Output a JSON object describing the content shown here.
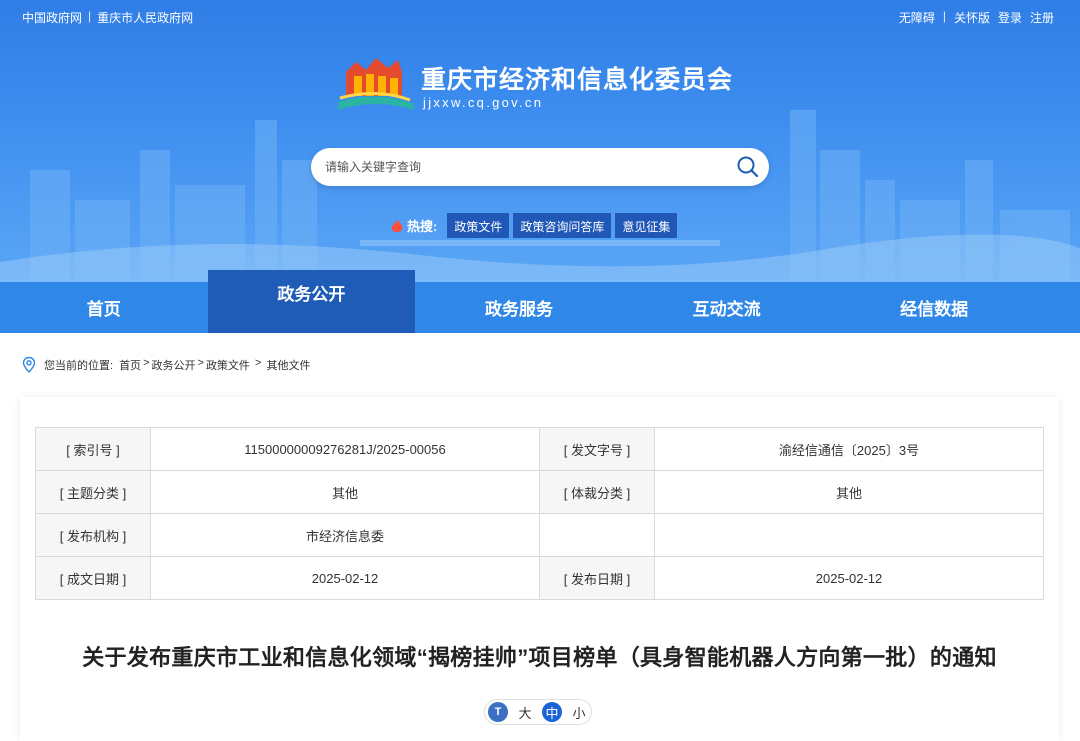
{
  "top_links_left": [
    "中国政府网",
    "重庆市人民政府网"
  ],
  "top_links_right": [
    "无障碍",
    "关怀版",
    "登录",
    "注册"
  ],
  "site": {
    "title": "重庆市经济和信息化委员会",
    "url": "jjxxw.cq.gov.cn"
  },
  "search": {
    "placeholder": "请输入关键字查询"
  },
  "hot": {
    "label": "热搜:",
    "tags": [
      "政策文件",
      "政策咨询问答库",
      "意见征集"
    ]
  },
  "nav": [
    "首页",
    "政务公开",
    "政务服务",
    "互动交流",
    "经信数据"
  ],
  "nav_active_index": 1,
  "breadcrumb": {
    "label": "您当前的位置:",
    "path": [
      "首页",
      ">",
      "政务公开",
      ">",
      "政策文件",
      " > ",
      "其他文件"
    ]
  },
  "meta": {
    "rows": [
      [
        "[ 索引号 ]",
        "11500000009276281J/2025-00056",
        "[ 发文字号 ]",
        "渝经信通信〔2025〕3号"
      ],
      [
        "[ 主题分类 ]",
        "其他",
        "[ 体裁分类 ]",
        "其他"
      ],
      [
        "[ 发布机构 ]",
        "市经济信息委",
        "",
        ""
      ],
      [
        "[ 成文日期 ]",
        "2025-02-12",
        "[ 发布日期 ]",
        "2025-02-12"
      ]
    ]
  },
  "doc_title": "关于发布重庆市工业和信息化领域“揭榜挂帅”项目榜单（具身智能机器人方向第一批）的通知",
  "font_size": {
    "icon": "T",
    "options": [
      "大",
      "中",
      "小"
    ],
    "active": "中"
  },
  "colors": {
    "brand_blue": "#2f87e8",
    "nav_active": "#1e5cb8",
    "hot_tag": "#2158b8"
  }
}
